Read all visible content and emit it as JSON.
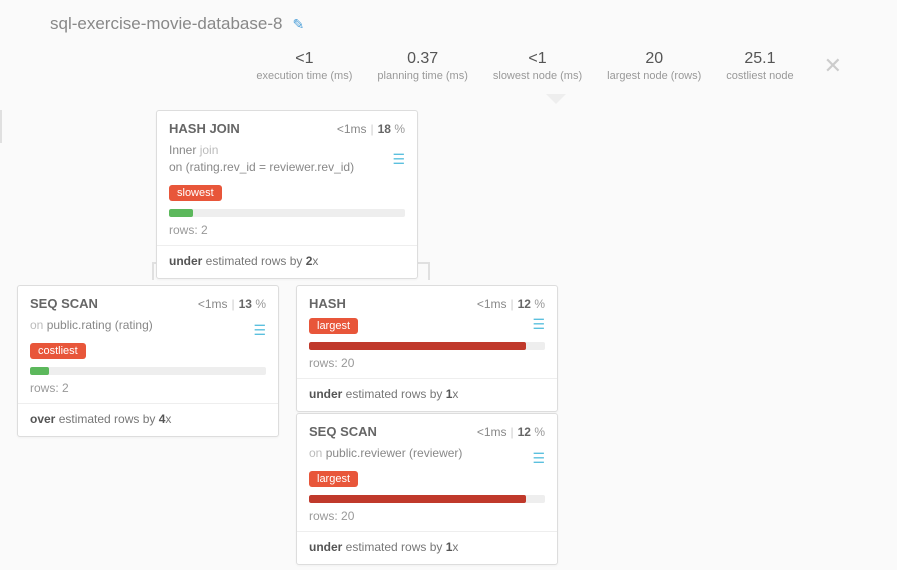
{
  "title": "sql-exercise-movie-database-8",
  "stats": {
    "exec_time": {
      "v": "<1",
      "l": "execution time (ms)"
    },
    "plan_time": {
      "v": "0.37",
      "l": "planning time (ms)"
    },
    "slowest": {
      "v": "<1",
      "l": "slowest node (ms)"
    },
    "largest": {
      "v": "20",
      "l": "largest node (rows)"
    },
    "costliest": {
      "v": "25.1",
      "l": "costliest node"
    }
  },
  "nodes": {
    "hashjoin": {
      "title": "HASH JOIN",
      "ms": "<1",
      "msunit": "ms",
      "pct": "18",
      "detail_prefix": "Inner",
      "detail_light": " join",
      "detail_line2": "on (rating.rev_id = reviewer.rev_id)",
      "tag": "slowest",
      "tag_color": "#e8563a",
      "bar_pct": 10,
      "bar_color": "#5cb85c",
      "rows_label": "rows:",
      "rows": "2",
      "est_dir": "under",
      "est_mid": " estimated rows by ",
      "est_x": "2",
      "est_suffix": "x"
    },
    "seq1": {
      "title": "SEQ SCAN",
      "ms": "<1",
      "msunit": "ms",
      "pct": "13",
      "detail_prefix": "on",
      "detail_rest": " public.rating (rating)",
      "tag": "costliest",
      "tag_color": "#e8563a",
      "bar_pct": 8,
      "bar_color": "#5cb85c",
      "rows_label": "rows:",
      "rows": "2",
      "est_dir": "over",
      "est_mid": " estimated rows by ",
      "est_x": "4",
      "est_suffix": "x"
    },
    "hash": {
      "title": "HASH",
      "ms": "<1",
      "msunit": "ms",
      "pct": "12",
      "tag": "largest",
      "tag_color": "#e8563a",
      "bar_pct": 92,
      "bar_color": "#c0392b",
      "rows_label": "rows:",
      "rows": "20",
      "est_dir": "under",
      "est_mid": " estimated rows by ",
      "est_x": "1",
      "est_suffix": "x"
    },
    "seq2": {
      "title": "SEQ SCAN",
      "ms": "<1",
      "msunit": "ms",
      "pct": "12",
      "detail_prefix": "on",
      "detail_rest": " public.reviewer (reviewer)",
      "tag": "largest",
      "tag_color": "#e8563a",
      "bar_pct": 92,
      "bar_color": "#c0392b",
      "rows_label": "rows:",
      "rows": "20",
      "est_dir": "under",
      "est_mid": " estimated rows by ",
      "est_x": "1",
      "est_suffix": "x"
    }
  }
}
